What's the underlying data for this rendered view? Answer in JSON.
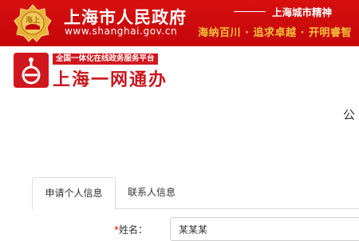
{
  "banner": {
    "gov_name": "上海市人民政府",
    "gov_url": "www.shanghai.gov.cn",
    "emblem_text": "海上",
    "spirit_title": "上海城市精神",
    "spirit_slogan": "海纳百川 · 追求卓越 · 开明睿智"
  },
  "platform": {
    "tag": "全国一体化在线政务服务平台",
    "name": "上海一网通办"
  },
  "page": {
    "title_fragment": "公"
  },
  "tabs": [
    {
      "label": "申请个人信息",
      "active": true
    },
    {
      "label": "联系人信息",
      "active": false
    }
  ],
  "form": {
    "name_label": "姓名：",
    "required_mark": "*",
    "name_value": "某某某"
  },
  "colors": {
    "banner_red": "#c4060a",
    "slogan_gold": "#f4c23a",
    "platform_red": "#d1171e"
  }
}
